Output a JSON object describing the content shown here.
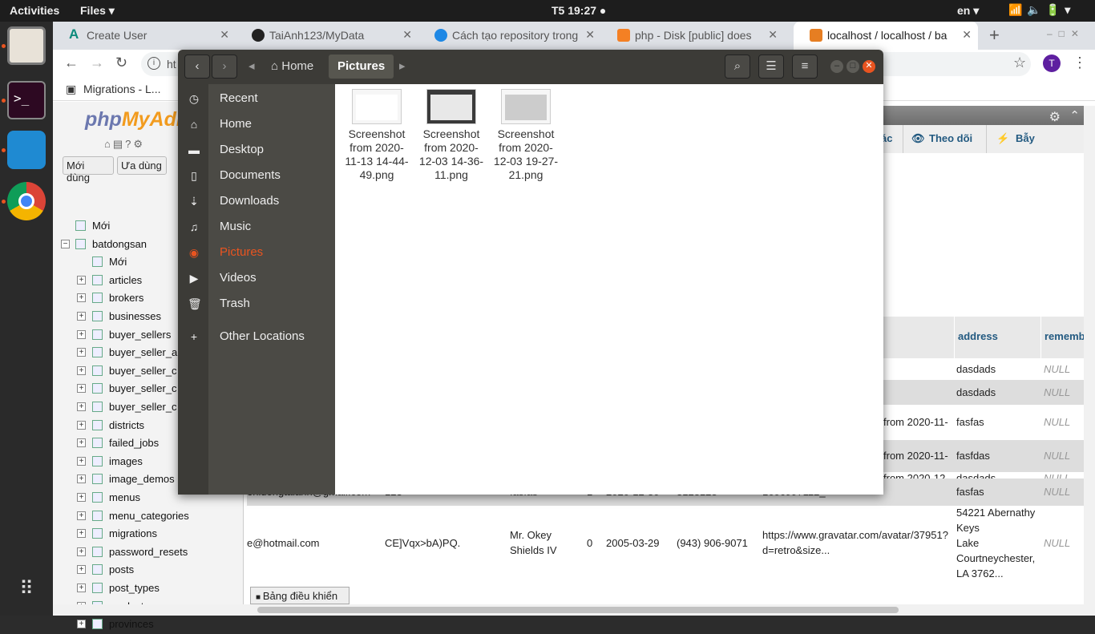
{
  "topbar": {
    "activities": "Activities",
    "app_menu": "Files ▾",
    "clock": "T5 19:27 ●",
    "language": "en ▾",
    "tray": "📶🔈🔋▾"
  },
  "browser": {
    "tabs": [
      {
        "label": "Create User",
        "icon_color": "#0b8a7b"
      },
      {
        "label": "TaiAnh123/MyData",
        "icon_color": "#222"
      },
      {
        "label": "Cách tạo repository trong",
        "icon_color": "#1e88e5"
      },
      {
        "label": "php - Disk [public] does",
        "icon_color": "#f48024"
      },
      {
        "label": "localhost / localhost / ba",
        "icon_color": "#e67e22"
      }
    ],
    "new_tab": "+",
    "url": "ht",
    "bookmark": "Migrations - L..."
  },
  "pma": {
    "logo_a": "php",
    "logo_b": "MyAdmin",
    "recent_btn": "Mới dùng",
    "fav_btn": "Ưa dùng",
    "tree": [
      "Mới",
      "batdongsan",
      "Mới",
      "articles",
      "brokers",
      "businesses",
      "buyer_sellers",
      "buyer_seller_a",
      "buyer_seller_c",
      "buyer_seller_c",
      "buyer_seller_c",
      "districts",
      "failed_jobs",
      "images",
      "image_demos",
      "menus",
      "menu_categories",
      "migrations",
      "password_resets",
      "posts",
      "post_types",
      "products",
      "provinces"
    ],
    "menu": [
      "ác",
      "Theo dõi",
      "Bẫy"
    ],
    "headers": [
      "address",
      "rememb"
    ],
    "rows": [
      {
        "col_img": "",
        "address": "dasdads",
        "remember": "NULL"
      },
      {
        "col_img": "",
        "address": "dasdads",
        "remember": "NULL"
      },
      {
        "col_img": "from 2020-11-",
        "address": "fasfas",
        "remember": "NULL"
      },
      {
        "col_img": "from 2020-11-",
        "address": "fasfdas",
        "remember": "NULL"
      },
      {
        "col_img": "from 2020-12-",
        "address": "dasdads",
        "remember": "NULL"
      }
    ],
    "row6": {
      "email": "enluongtaianh@gmail.com",
      "pass": "123",
      "name": "fasfas",
      "flag": "1",
      "date": "2020-12-30",
      "phone": "3123123",
      "img": "1606997112_",
      "address": "fasfas",
      "remember": "NULL"
    },
    "row7": {
      "email": "e@hotmail.com",
      "pass": "CE]Vqx>bA)PQ.",
      "name1": "Mr. Okey",
      "name2": "Shields IV",
      "flag": "0",
      "date": "2005-03-29",
      "phone": "(943) 906-9071",
      "img1": "https://www.gravatar.com/avatar/37951?",
      "img2": "d=retro&size...",
      "addr1": "54221 Abernathy",
      "addr2": "Keys",
      "addr3": "Lake",
      "addr4": "Courtneychester,",
      "addr5": "LA 3762...",
      "remember": "NULL"
    },
    "console": "Bảng điều khiển"
  },
  "files": {
    "path": [
      "Home",
      "Pictures"
    ],
    "sidebar": [
      "Recent",
      "Home",
      "Desktop",
      "Documents",
      "Downloads",
      "Music",
      "Pictures",
      "Videos",
      "Trash",
      "Other Locations"
    ],
    "selected": "Pictures",
    "items": [
      {
        "l1": "Screenshot",
        "l2": "from 2020-",
        "l3": "11-13 14-44-",
        "l4": "49.png"
      },
      {
        "l1": "Screenshot",
        "l2": "from 2020-",
        "l3": "12-03 14-36-",
        "l4": "11.png"
      },
      {
        "l1": "Screenshot",
        "l2": "from 2020-",
        "l3": "12-03 19-27-",
        "l4": "21.png"
      }
    ]
  }
}
